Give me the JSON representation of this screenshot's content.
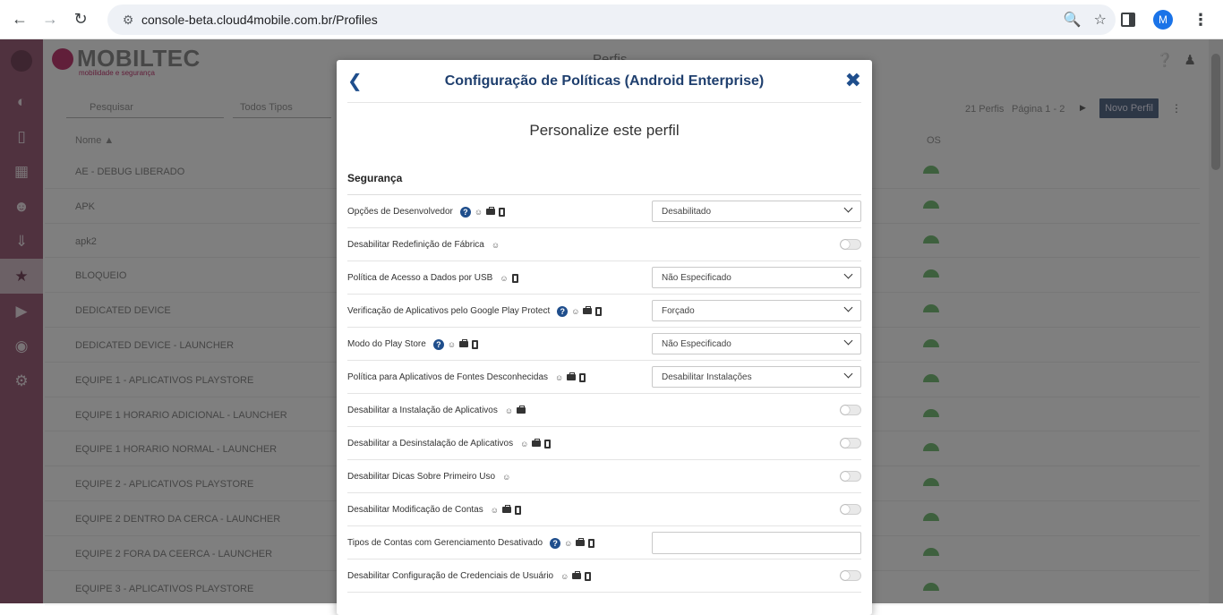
{
  "browser": {
    "url": "console-beta.cloud4mobile.com.br/Profiles",
    "profile_initial": "M"
  },
  "app": {
    "brand_name": "MOBILTEC",
    "brand_tagline": "mobilidade e segurança",
    "page_title": "Perfis",
    "search_placeholder": "Pesquisar",
    "type_filter": "Todos Tipos",
    "count_text": "21 Perfis",
    "page_text": "Página 1 - 2",
    "new_profile_label": "Novo Perfil",
    "columns": {
      "name": "Nome",
      "os": "OS"
    },
    "profiles": [
      "AE - DEBUG LIBERADO",
      "APK",
      "apk2",
      "BLOQUEIO",
      "DEDICATED DEVICE",
      "DEDICATED DEVICE - LAUNCHER",
      "EQUIPE 1 - APLICATIVOS PLAYSTORE",
      "EQUIPE 1 HORARIO ADICIONAL - LAUNCHER",
      "EQUIPE 1 HORARIO NORMAL - LAUNCHER",
      "EQUIPE 2 - APLICATIVOS PLAYSTORE",
      "EQUIPE 2 DENTRO DA CERCA - LAUNCHER",
      "EQUIPE 2 FORA DA CEERCA - LAUNCHER",
      "EQUIPE 3 - APLICATIVOS PLAYSTORE"
    ],
    "colors": {
      "sidebar": "#a0647f",
      "brand": "#c23f74",
      "android": "#7cc17c"
    }
  },
  "modal": {
    "title": "Configuração de Políticas (Android Enterprise)",
    "subtitle": "Personalize este perfil",
    "section": "Segurança",
    "rows": [
      {
        "label": "Opções de Desenvolvedor",
        "value": "Desabilitado"
      },
      {
        "label": "Desabilitar Redefinição de Fábrica",
        "value": ""
      },
      {
        "label": "Política de Acesso a Dados por USB",
        "value": "Não Especificado"
      },
      {
        "label": "Verificação de Aplicativos pelo Google Play Protect",
        "value": "Forçado"
      },
      {
        "label": "Modo do Play Store",
        "value": "Não Especificado"
      },
      {
        "label": "Política para Aplicativos de Fontes Desconhecidas",
        "value": "Desabilitar Instalações"
      },
      {
        "label": "Desabilitar a Instalação de Aplicativos",
        "value": ""
      },
      {
        "label": "Desabilitar a Desinstalação de Aplicativos",
        "value": ""
      },
      {
        "label": "Desabilitar Dicas Sobre Primeiro Uso",
        "value": ""
      },
      {
        "label": "Desabilitar Modificação de Contas",
        "value": ""
      },
      {
        "label": "Tipos de Contas com Gerenciamento Desativado",
        "value": ""
      },
      {
        "label": "Desabilitar Configuração de Credenciais de Usuário",
        "value": ""
      }
    ],
    "accent": "#1f4e8c"
  }
}
